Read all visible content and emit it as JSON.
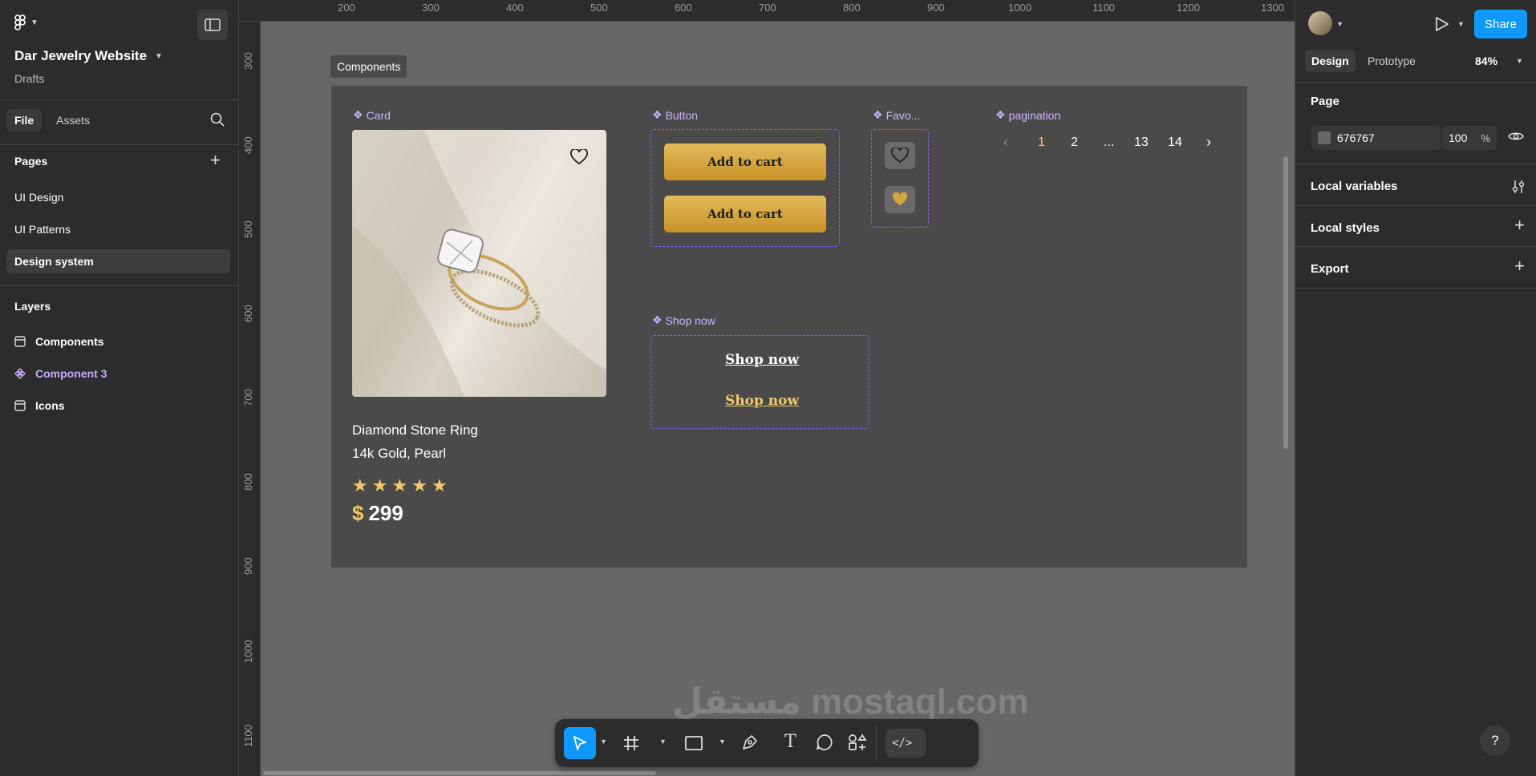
{
  "app": {
    "file_name": "Dar Jewelry Website",
    "project": "Drafts"
  },
  "left_panel": {
    "tabs": [
      "File",
      "Assets"
    ],
    "pages_title": "Pages",
    "pages": [
      "UI Design",
      "UI Patterns",
      "Design system"
    ],
    "active_page": "Design system",
    "layers_title": "Layers",
    "layers": [
      {
        "name": "Components",
        "icon": "frame-icon"
      },
      {
        "name": "Component 3",
        "icon": "component-icon"
      },
      {
        "name": "Icons",
        "icon": "frame-icon"
      }
    ]
  },
  "rulers": {
    "top": [
      "200",
      "300",
      "400",
      "500",
      "600",
      "700",
      "800",
      "900",
      "1000",
      "1100",
      "1200",
      "1300"
    ],
    "left": [
      "300",
      "400",
      "500",
      "600",
      "700",
      "800",
      "900",
      "1000",
      "1100"
    ]
  },
  "canvas": {
    "frame_label": "Components",
    "card": {
      "label": "Card",
      "product_name": "Diamond Stone Ring",
      "product_desc": "14k Gold, Pearl",
      "rating_stars": 5,
      "currency": "$",
      "price": "299"
    },
    "button": {
      "label": "Button",
      "buttons": [
        "Add to cart",
        "Add to cart"
      ]
    },
    "favorite": {
      "label": "Favo..."
    },
    "pagination": {
      "label": "pagination",
      "pages": [
        "1",
        "2",
        "...",
        "13",
        "14"
      ],
      "active": "1"
    },
    "shop_now": {
      "label": "Shop now",
      "links": [
        "Shop now",
        "Shop now"
      ]
    },
    "watermark": "مستقل mostaql.com"
  },
  "toolbar": {
    "tools": [
      "move-tool",
      "frame-tool",
      "shape-tool",
      "pen-tool",
      "text-tool",
      "comment-tool",
      "actions-tool",
      "dev-mode-toggle"
    ]
  },
  "right_panel": {
    "tabs": [
      "Design",
      "Prototype"
    ],
    "zoom": "84%",
    "share_label": "Share",
    "page_section": "Page",
    "page_color": "676767",
    "page_opacity": "100",
    "percent": "%",
    "sections": [
      "Local variables",
      "Local styles",
      "Export"
    ]
  },
  "colors": {
    "accent_blue": "#0d99ff",
    "gold": "#d4a640",
    "component_purple": "#8b5cf6",
    "canvas_bg": "#676767"
  },
  "help_label": "?"
}
